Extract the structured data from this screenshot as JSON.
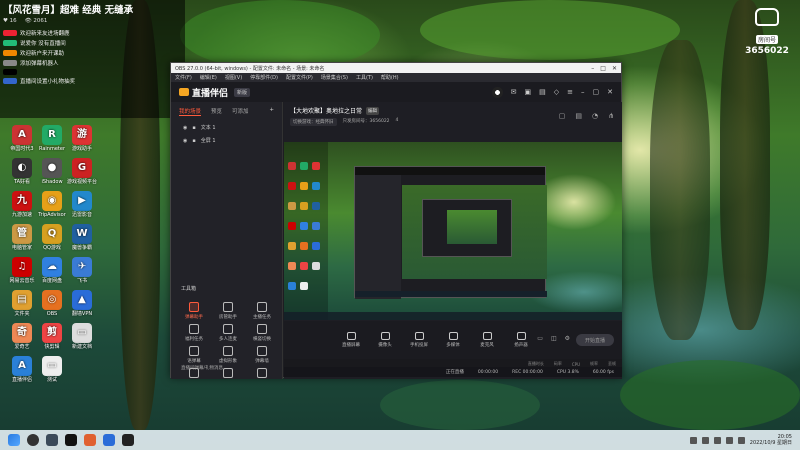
{
  "overlay": {
    "title": "【风花雪月】超难 经典 无缝承",
    "stats": [
      "♥ 16",
      "👁 2061"
    ],
    "lines": [
      {
        "text": "欢迎新来友进场翻鹿",
        "badge": "#e23"
      },
      {
        "text": "说爱你 没有直播间",
        "badge": "#2b7"
      },
      {
        "text": "欢迎新户来开课助",
        "badge": "#e80"
      },
      {
        "text": "添加弹幕机器人",
        "badge": "#888"
      },
      {
        "text": "",
        "badge": "#000"
      },
      {
        "text": "直播间设置小礼物抽奖",
        "badge": "#36c"
      }
    ]
  },
  "room": {
    "label": "房间号",
    "number": "3656022"
  },
  "desktop_icons": [
    {
      "label": "帝国时代3",
      "color": "#c33",
      "glyph": "A"
    },
    {
      "label": "Rainmeter",
      "color": "#2a6",
      "glyph": "R"
    },
    {
      "label": "游戏助手",
      "color": "#d33",
      "glyph": "游"
    },
    {
      "label": "TA好看",
      "color": "#333",
      "glyph": "◐"
    },
    {
      "label": "iShadow",
      "color": "#555",
      "glyph": "●"
    },
    {
      "label": "游戏视频平台",
      "color": "#c22",
      "glyph": "G"
    },
    {
      "label": "九游加速",
      "color": "#c11",
      "glyph": "九"
    },
    {
      "label": "TripAdvisor",
      "color": "#e7a018",
      "glyph": "◉"
    },
    {
      "label": "迅雷影音",
      "color": "#28c",
      "glyph": "▶"
    },
    {
      "label": "电脑管家",
      "color": "#c94",
      "glyph": "管"
    },
    {
      "label": "QQ游戏",
      "color": "#d7a020",
      "glyph": "Q"
    },
    {
      "label": "魔兽争霸",
      "color": "#2060a0",
      "glyph": "W"
    },
    {
      "label": "网易云音乐",
      "color": "#c00",
      "glyph": "♫"
    },
    {
      "label": "百度网盘",
      "color": "#3080e0",
      "glyph": "☁"
    },
    {
      "label": "飞书",
      "color": "#3a7bd5",
      "glyph": "✈"
    },
    {
      "label": "文件夹",
      "color": "#e0a030",
      "glyph": "▤"
    },
    {
      "label": "OBS",
      "color": "#e67020",
      "glyph": "◎"
    },
    {
      "label": "翻墙VPN",
      "color": "#2a6cd8",
      "glyph": "▲"
    },
    {
      "label": "爱奇艺",
      "color": "#e85",
      "glyph": "奇"
    },
    {
      "label": "快剪辑",
      "color": "#e44",
      "glyph": "剪"
    },
    {
      "label": "新建文档",
      "color": "#ddd",
      "glyph": "▭"
    },
    {
      "label": "直播伴侣",
      "color": "#2a80d8",
      "glyph": "A"
    },
    {
      "label": "测试",
      "color": "#eee",
      "glyph": "▭"
    }
  ],
  "obs": {
    "titlebar": "OBS 27.0.0 (64-bit, windows) - 配置文件: 未命名 - 场景: 未命名",
    "menu": [
      "文件(F)",
      "编辑(E)",
      "视图(V)",
      "停靠部件(D)",
      "配置文件(P)",
      "场景集合(S)",
      "工具(T)",
      "帮助(H)"
    ],
    "app_name": "直播伴侣",
    "version": "新版",
    "left_tabs": [
      "我的场景",
      "预览",
      "可添加"
    ],
    "scenes": [
      "文本 1",
      "全屏 1"
    ],
    "tools_title": "工具箱",
    "tools": [
      "弹幕助手",
      "房管助手",
      "主播任务",
      "福利任务",
      "多人连麦",
      "横竖切换",
      "语弹幕",
      "虚拟形象",
      "弹幕墙",
      "",
      "",
      ""
    ],
    "bottom_tip": "直播间弹幕/礼物消息",
    "room_title": "【大地欢聚】奥地拉之日常",
    "room_tag": "编辑",
    "sub_items": [
      "切换游戏：经典怀旧",
      "只发房间号：3656022",
      "4"
    ],
    "controls": [
      "直播屏幕",
      "摄像头",
      "手机投屏",
      "多媒体",
      "麦克风",
      "扬声器"
    ],
    "go_live": "开始直播",
    "status_bits": [
      "直播时长",
      "码率",
      "CPU",
      "帧率",
      "丢帧"
    ],
    "status2": [
      "正在直播",
      "00:00:00",
      "REC 00:00:00",
      "CPU 3.8%",
      "60.00 fps"
    ]
  },
  "taskbar": {
    "time": "20:05",
    "date": "2022/10/9 星期日"
  }
}
